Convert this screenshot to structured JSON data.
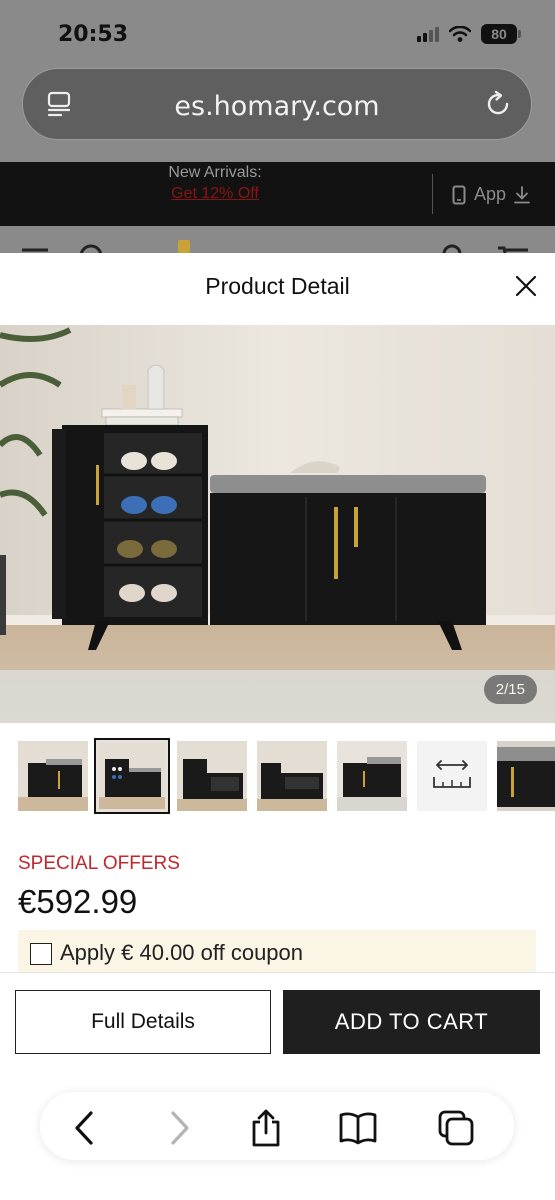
{
  "status_bar": {
    "time": "20:53",
    "battery": "80"
  },
  "browser": {
    "url": "es.homary.com"
  },
  "promo": {
    "title": "New Arrivals:",
    "link": "Get 12% Off",
    "app_label": "App"
  },
  "modal": {
    "title": "Product Detail",
    "image_counter": "2/15",
    "special_offers": "SPECIAL OFFERS",
    "price": "€592.99",
    "coupon": "Apply € 40.00 off coupon"
  },
  "actions": {
    "full_details": "Full Details",
    "add_to_cart": "ADD TO CART"
  },
  "icons": {
    "reader": "reader-icon",
    "reload": "reload-icon",
    "close": "close-icon",
    "back": "chevron-left-icon",
    "forward": "chevron-right-icon",
    "share": "share-icon",
    "bookmarks": "book-icon",
    "tabs": "tabs-icon"
  },
  "colors": {
    "accent_red": "#c0282d",
    "cart_button": "#1f1f1f",
    "coupon_bg": "#fbf5e6"
  }
}
